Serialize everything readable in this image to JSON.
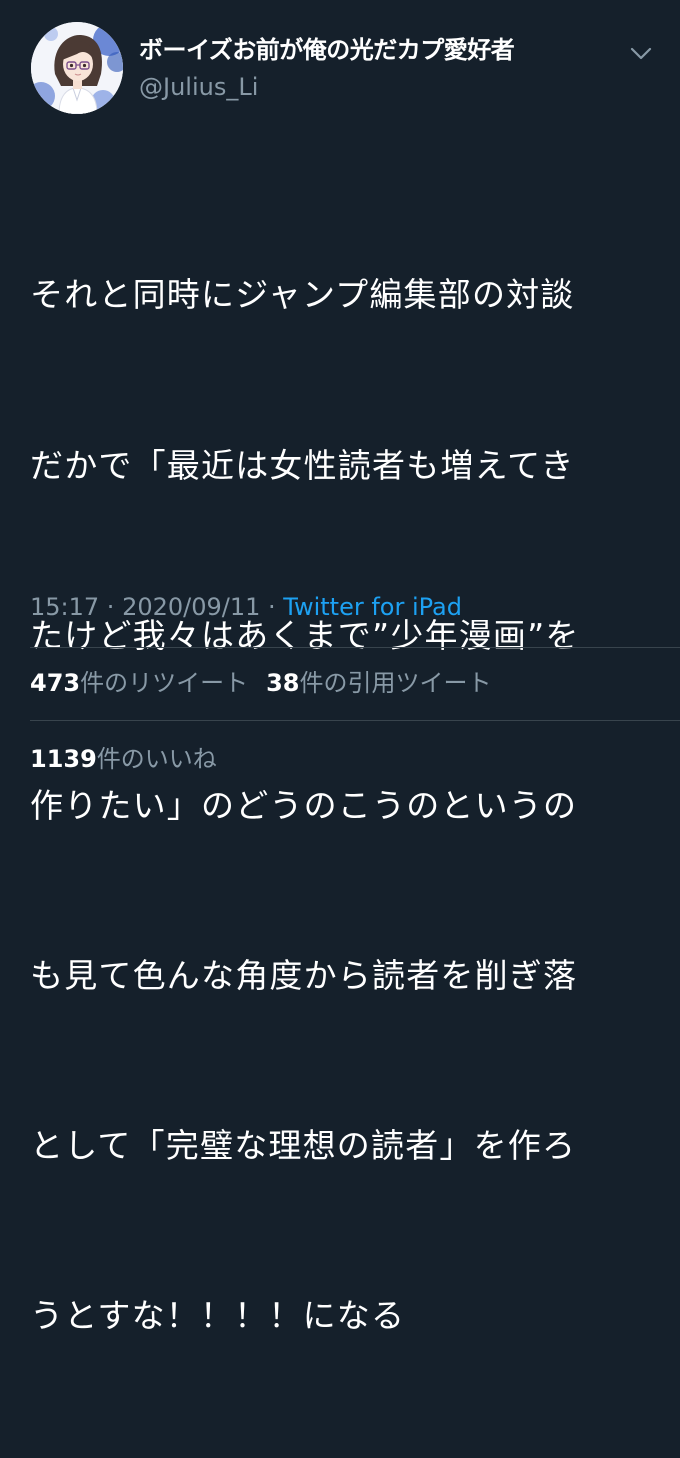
{
  "user": {
    "display_name": "ボーイズお前が俺の光だカプ愛好者",
    "handle": "@Julius_Li",
    "avatar_icon": "user-avatar-illustration"
  },
  "tweet": {
    "text_lines": [
      "それと同時にジャンプ編集部の対談",
      "だかで「最近は女性読者も増えてき",
      "たけど我々はあくまで”少年漫画”を",
      "作りたい」のどうのこうのというの",
      "も見て色んな角度から読者を削ぎ落",
      "として「完璧な理想の読者」を作ろ",
      "うとすな！！！！になる"
    ],
    "time": "15:17",
    "date": "2020/09/11",
    "separator": " · ",
    "source": "Twitter for iPad"
  },
  "stats": {
    "retweets_count": "473",
    "retweets_label": "件のリツイート",
    "quotes_count": "38",
    "quotes_label": "件の引用ツイート",
    "likes_count": "1139",
    "likes_label": "件のいいね"
  },
  "colors": {
    "background": "#15202b",
    "text": "#ffffff",
    "secondary": "#8899a6",
    "link": "#1da1f2",
    "divider": "#38444d"
  },
  "icons": {
    "menu": "chevron-down-icon"
  }
}
